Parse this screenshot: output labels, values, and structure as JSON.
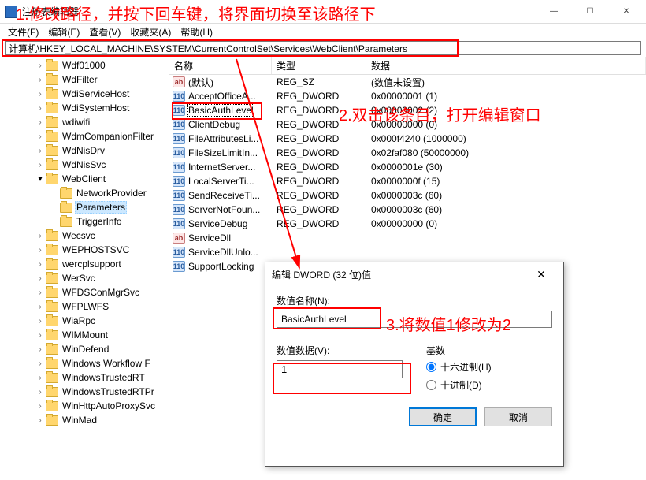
{
  "window": {
    "title": "注册表编辑器",
    "min": "—",
    "max": "☐",
    "close": "✕"
  },
  "menu": {
    "file": "文件(F)",
    "edit": "编辑(E)",
    "view": "查看(V)",
    "fav": "收藏夹(A)",
    "help": "帮助(H)"
  },
  "address": "计算机\\HKEY_LOCAL_MACHINE\\SYSTEM\\CurrentControlSet\\Services\\WebClient\\Parameters",
  "tree": [
    {
      "ind": 40,
      "chev": ">",
      "label": "Wdf01000"
    },
    {
      "ind": 40,
      "chev": ">",
      "label": "WdFilter"
    },
    {
      "ind": 40,
      "chev": ">",
      "label": "WdiServiceHost"
    },
    {
      "ind": 40,
      "chev": ">",
      "label": "WdiSystemHost"
    },
    {
      "ind": 40,
      "chev": ">",
      "label": "wdiwifi"
    },
    {
      "ind": 40,
      "chev": ">",
      "label": "WdmCompanionFilter"
    },
    {
      "ind": 40,
      "chev": ">",
      "label": "WdNisDrv"
    },
    {
      "ind": 40,
      "chev": ">",
      "label": "WdNisSvc"
    },
    {
      "ind": 40,
      "chev": "v",
      "label": "WebClient",
      "open": true
    },
    {
      "ind": 58,
      "chev": "",
      "label": "NetworkProvider"
    },
    {
      "ind": 58,
      "chev": "",
      "label": "Parameters",
      "sel": true
    },
    {
      "ind": 58,
      "chev": "",
      "label": "TriggerInfo"
    },
    {
      "ind": 40,
      "chev": ">",
      "label": "Wecsvc"
    },
    {
      "ind": 40,
      "chev": ">",
      "label": "WEPHOSTSVC"
    },
    {
      "ind": 40,
      "chev": ">",
      "label": "wercplsupport"
    },
    {
      "ind": 40,
      "chev": ">",
      "label": "WerSvc"
    },
    {
      "ind": 40,
      "chev": ">",
      "label": "WFDSConMgrSvc"
    },
    {
      "ind": 40,
      "chev": ">",
      "label": "WFPLWFS"
    },
    {
      "ind": 40,
      "chev": ">",
      "label": "WiaRpc"
    },
    {
      "ind": 40,
      "chev": ">",
      "label": "WIMMount"
    },
    {
      "ind": 40,
      "chev": ">",
      "label": "WinDefend"
    },
    {
      "ind": 40,
      "chev": ">",
      "label": "Windows Workflow F"
    },
    {
      "ind": 40,
      "chev": ">",
      "label": "WindowsTrustedRT"
    },
    {
      "ind": 40,
      "chev": ">",
      "label": "WindowsTrustedRTPr"
    },
    {
      "ind": 40,
      "chev": ">",
      "label": "WinHttpAutoProxySvc"
    },
    {
      "ind": 40,
      "chev": ">",
      "label": "WinMad"
    }
  ],
  "cols": {
    "name": "名称",
    "type": "类型",
    "data": "数据"
  },
  "colw": {
    "name": 130,
    "type": 120,
    "data": 300
  },
  "rows": [
    {
      "icon": "sz",
      "name": "(默认)",
      "type": "REG_SZ",
      "data": "(数值未设置)"
    },
    {
      "icon": "dw",
      "name": "AcceptOfficeA...",
      "type": "REG_DWORD",
      "data": "0x00000001 (1)"
    },
    {
      "icon": "dw",
      "name": "BasicAuthLevel",
      "type": "REG_DWORD",
      "data": "0x00000002 (2)",
      "sel": true
    },
    {
      "icon": "dw",
      "name": "ClientDebug",
      "type": "REG_DWORD",
      "data": "0x00000000 (0)"
    },
    {
      "icon": "dw",
      "name": "FileAttributesLi...",
      "type": "REG_DWORD",
      "data": "0x000f4240 (1000000)"
    },
    {
      "icon": "dw",
      "name": "FileSizeLimitIn...",
      "type": "REG_DWORD",
      "data": "0x02faf080 (50000000)"
    },
    {
      "icon": "dw",
      "name": "InternetServer...",
      "type": "REG_DWORD",
      "data": "0x0000001e (30)"
    },
    {
      "icon": "dw",
      "name": "LocalServerTi...",
      "type": "REG_DWORD",
      "data": "0x0000000f (15)"
    },
    {
      "icon": "dw",
      "name": "SendReceiveTi...",
      "type": "REG_DWORD",
      "data": "0x0000003c (60)"
    },
    {
      "icon": "dw",
      "name": "ServerNotFoun...",
      "type": "REG_DWORD",
      "data": "0x0000003c (60)"
    },
    {
      "icon": "dw",
      "name": "ServiceDebug",
      "type": "REG_DWORD",
      "data": "0x00000000 (0)"
    },
    {
      "icon": "sz",
      "name": "ServiceDll",
      "type": "",
      "data": ""
    },
    {
      "icon": "dw",
      "name": "ServiceDllUnlo...",
      "type": "",
      "data": ""
    },
    {
      "icon": "dw",
      "name": "SupportLocking",
      "type": "",
      "data": ""
    }
  ],
  "dialog": {
    "title": "编辑 DWORD (32 位)值",
    "name_label": "数值名称(N):",
    "name_value": "BasicAuthLevel",
    "data_label": "数值数据(V):",
    "data_value": "1",
    "base_label": "基数",
    "hex": "十六进制(H)",
    "dec": "十进制(D)",
    "ok": "确定",
    "cancel": "取消"
  },
  "annotations": {
    "a1": "1.修改路径，并按下回车键，将界面切换至该路径下",
    "a2": "2.双击该条目，打开编辑窗口",
    "a3": "3.将数值1修改为2"
  },
  "iconglyph": {
    "sz": "ab",
    "dw": "110"
  }
}
